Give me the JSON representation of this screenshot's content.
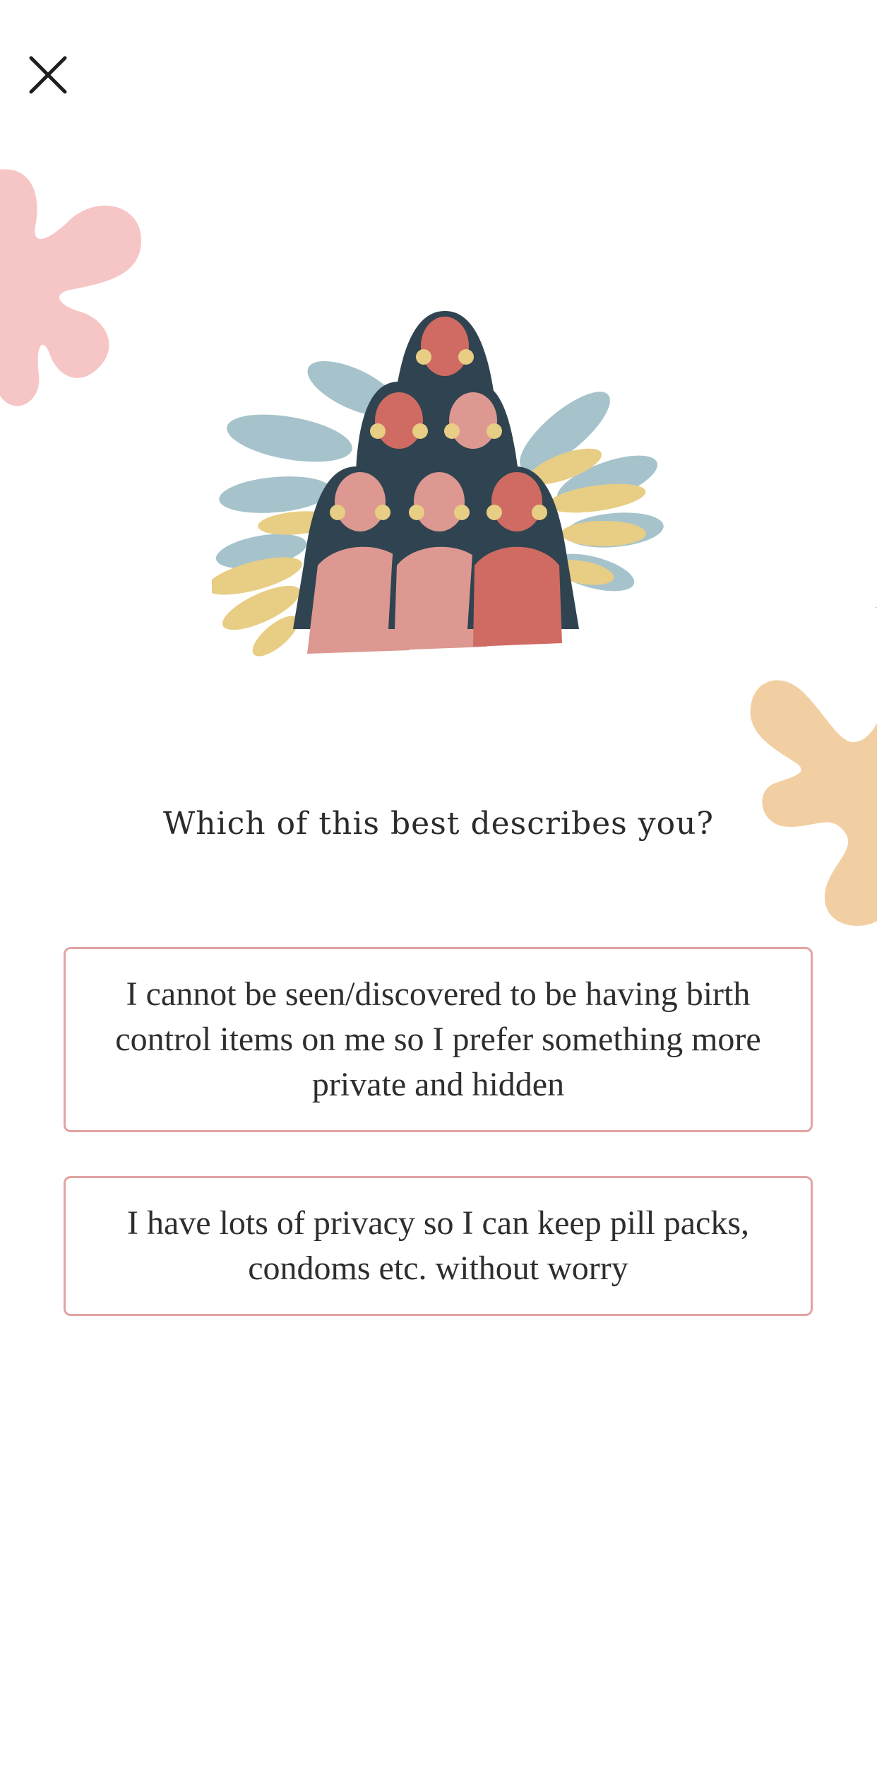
{
  "header": {
    "close_icon": "close-icon"
  },
  "question": "Which of this best describes you?",
  "options": [
    {
      "label": "I cannot be seen/discovered to be having birth control items on me so I prefer something more private and hidden"
    },
    {
      "label": "I have lots of privacy so I can keep pill packs, condoms etc. without worry"
    }
  ],
  "colors": {
    "accent_border": "#e3a3a3",
    "blob_pink": "#f6c6c6",
    "blob_peach": "#f2cfa3",
    "hair": "#2f4450",
    "skin": "#cf6b62",
    "top_light": "#dd9891",
    "leaf_blue": "#a6c3cc",
    "leaf_yellow": "#e8cd84"
  }
}
